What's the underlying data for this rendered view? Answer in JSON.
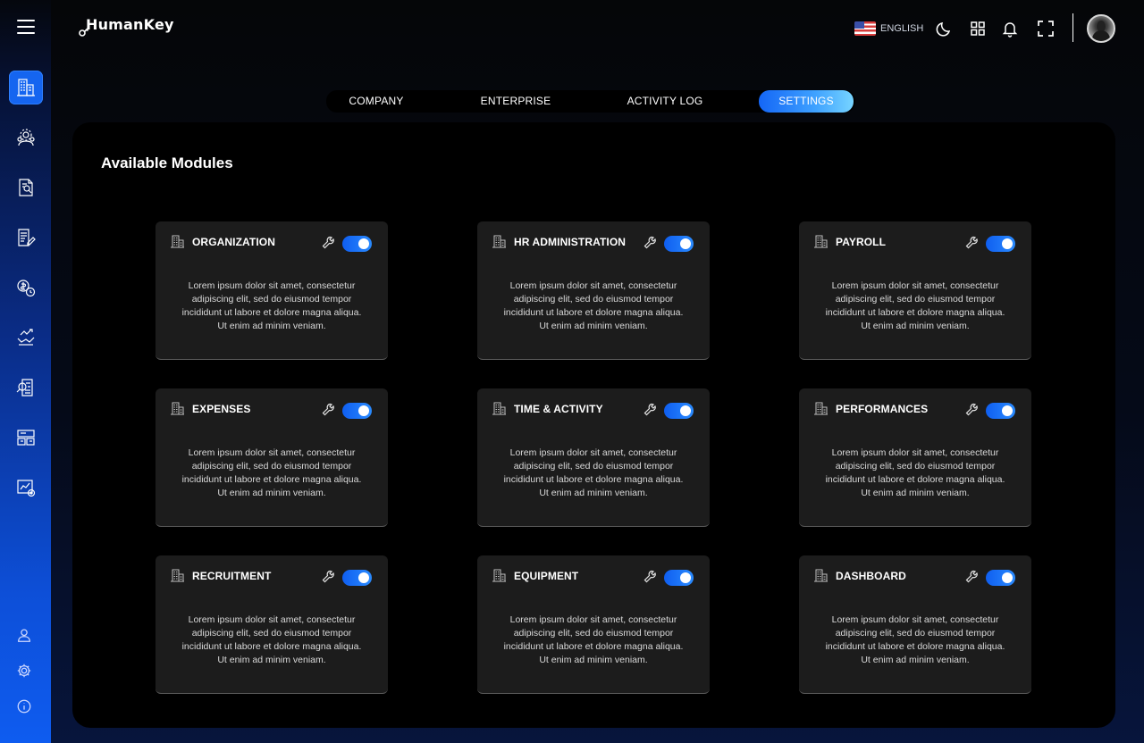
{
  "app": {
    "name": "HumanKey"
  },
  "header": {
    "language": "ENGLISH",
    "icons": [
      "moon-icon",
      "apps-grid-icon",
      "bell-icon",
      "fullscreen-icon"
    ]
  },
  "sidebar": {
    "items": [
      "buildings-icon",
      "team-gear-icon",
      "document-user-icon",
      "document-edit-icon",
      "money-clock-icon",
      "performance-icon",
      "search-document-icon",
      "equipment-icon",
      "chart-settings-icon"
    ],
    "bottom": [
      "user-icon",
      "settings-icon",
      "info-icon"
    ]
  },
  "tabs": [
    {
      "label": "COMPANY",
      "active": false
    },
    {
      "label": "ENTERPRISE",
      "active": false
    },
    {
      "label": "ACTIVITY LOG",
      "active": false
    },
    {
      "label": "SETTINGS",
      "active": true
    }
  ],
  "main": {
    "title": "Available Modules",
    "modules": [
      {
        "title": "ORGANIZATION",
        "enabled": true,
        "description": "Lorem ipsum dolor sit amet, consectetur adipiscing elit, sed do eiusmod tempor incididunt ut labore et dolore magna aliqua. Ut enim ad minim veniam."
      },
      {
        "title": "HR ADMINISTRATION",
        "enabled": true,
        "description": "Lorem ipsum dolor sit amet, consectetur adipiscing elit, sed do eiusmod tempor incididunt ut labore et dolore magna aliqua. Ut enim ad minim veniam."
      },
      {
        "title": "PAYROLL",
        "enabled": true,
        "description": "Lorem ipsum dolor sit amet, consectetur adipiscing elit, sed do eiusmod tempor incididunt ut labore et dolore magna aliqua. Ut enim ad minim veniam."
      },
      {
        "title": "EXPENSES",
        "enabled": true,
        "description": "Lorem ipsum dolor sit amet, consectetur adipiscing elit, sed do eiusmod tempor incididunt ut labore et dolore magna aliqua. Ut enim ad minim veniam."
      },
      {
        "title": "TIME & ACTIVITY",
        "enabled": true,
        "description": "Lorem ipsum dolor sit amet, consectetur adipiscing elit, sed do eiusmod tempor incididunt ut labore et dolore magna aliqua. Ut enim ad minim veniam."
      },
      {
        "title": "PERFORMANCES",
        "enabled": true,
        "description": "Lorem ipsum dolor sit amet, consectetur adipiscing elit, sed do eiusmod tempor incididunt ut labore et dolore magna aliqua. Ut enim ad minim veniam."
      },
      {
        "title": "RECRUITMENT",
        "enabled": true,
        "description": "Lorem ipsum dolor sit amet, consectetur adipiscing elit, sed do eiusmod tempor incididunt ut labore et dolore magna aliqua. Ut enim ad minim veniam."
      },
      {
        "title": "EQUIPMENT",
        "enabled": true,
        "description": "Lorem ipsum dolor sit amet, consectetur adipiscing elit, sed do eiusmod tempor incididunt ut labore et dolore magna aliqua. Ut enim ad minim veniam."
      },
      {
        "title": "DASHBOARD",
        "enabled": true,
        "description": "Lorem ipsum dolor sit amet, consectetur adipiscing elit, sed do eiusmod tempor incididunt ut labore et dolore magna aliqua. Ut enim ad minim veniam."
      }
    ]
  },
  "colors": {
    "accent": "#1466f6",
    "accent_light": "#77d4ff",
    "card_bg": "#1c1c1c",
    "panel_bg": "#000000"
  }
}
